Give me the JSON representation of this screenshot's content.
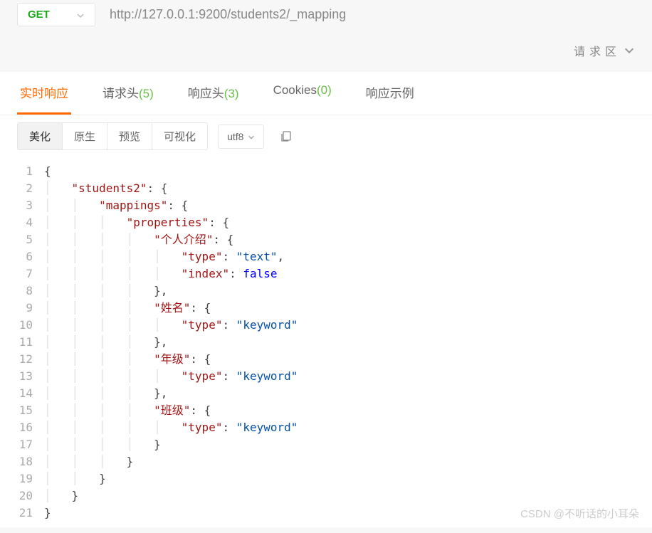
{
  "request": {
    "method": "GET",
    "url": "http://127.0.0.1:9200/students2/_mapping"
  },
  "request_zone_label": "请求区",
  "tabs": {
    "realtime": "实时响应",
    "req_header": {
      "label": "请求头",
      "count": "(5)"
    },
    "res_header": {
      "label": "响应头",
      "count": "(3)"
    },
    "cookies": {
      "label": "Cookies",
      "count": "(0)"
    },
    "example": "响应示例"
  },
  "toolbar": {
    "beautify": "美化",
    "raw": "原生",
    "preview": "预览",
    "visualize": "可视化",
    "encoding": "utf8"
  },
  "code": {
    "lines": [
      "1",
      "2",
      "3",
      "4",
      "5",
      "6",
      "7",
      "8",
      "9",
      "10",
      "11",
      "12",
      "13",
      "14",
      "15",
      "16",
      "17",
      "18",
      "19",
      "20",
      "21"
    ]
  },
  "response_json": {
    "students2": {
      "mappings": {
        "properties": {
          "个人介绍": {
            "type": "text",
            "index": false
          },
          "姓名": {
            "type": "keyword"
          },
          "年级": {
            "type": "keyword"
          },
          "班级": {
            "type": "keyword"
          }
        }
      }
    }
  },
  "json_keys": {
    "students2": "\"students2\"",
    "mappings": "\"mappings\"",
    "properties": "\"properties\"",
    "intro": "\"个人介绍\"",
    "type": "\"type\"",
    "index": "\"index\"",
    "name": "\"姓名\"",
    "grade": "\"年级\"",
    "class": "\"班级\""
  },
  "json_vals": {
    "text": "\"text\"",
    "keyword": "\"keyword\"",
    "false": "false"
  },
  "watermark": "CSDN @不听话的小耳朵"
}
